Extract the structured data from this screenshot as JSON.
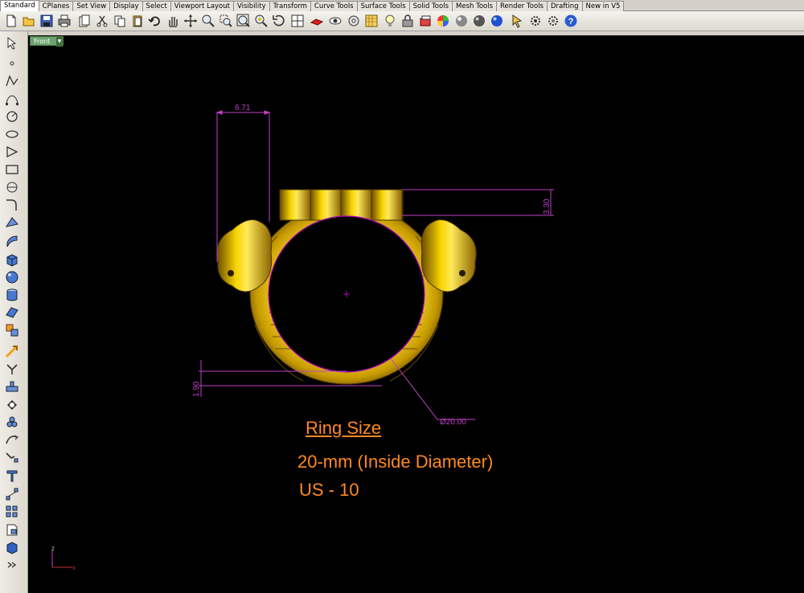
{
  "tabs": [
    "Standard",
    "CPlanes",
    "Set View",
    "Display",
    "Select",
    "Viewport Layout",
    "Visibility",
    "Transform",
    "Curve Tools",
    "Surface Tools",
    "Solid Tools",
    "Mesh Tools",
    "Render Tools",
    "Drafting",
    "New in V5"
  ],
  "viewport": {
    "title": "Front"
  },
  "dimensions": {
    "width_top": "6.71",
    "height_right": "3.30",
    "thickness_left": "1.90",
    "diameter": "Ø20.00"
  },
  "annotation": {
    "title": "Ring Size",
    "line1": "20-mm (Inside Diameter)",
    "line2": "US - 10"
  },
  "axis": {
    "z_label": "z",
    "x_label": "x"
  },
  "colors": {
    "dimension": "#c040c8",
    "annotation": "#ff8a1f",
    "ring_gold": "#e6c200",
    "viewport_bg": "#000000"
  }
}
